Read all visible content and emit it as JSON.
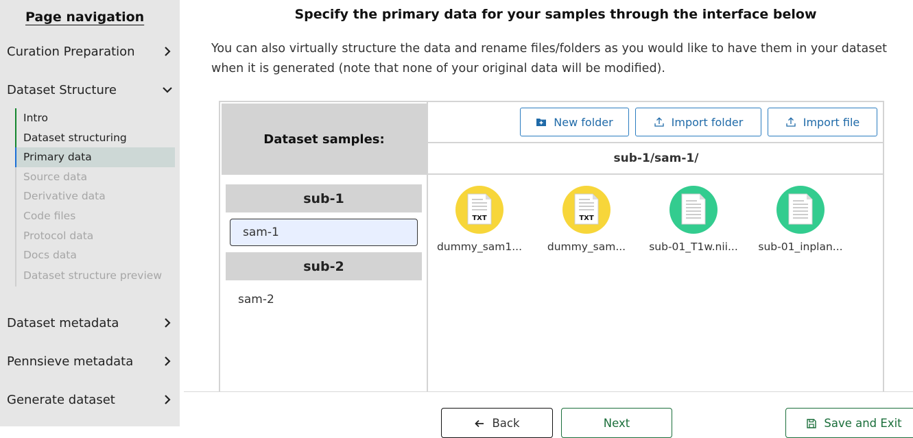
{
  "sidebar": {
    "title": "Page navigation",
    "sections": [
      {
        "label": "Curation Preparation",
        "icon": "chevron-right-icon"
      },
      {
        "label": "Dataset Structure",
        "icon": "chevron-down-icon"
      },
      {
        "label": "Dataset metadata",
        "icon": "chevron-right-icon"
      },
      {
        "label": "Pennsieve metadata",
        "icon": "chevron-right-icon"
      },
      {
        "label": "Generate dataset",
        "icon": "chevron-right-icon"
      }
    ],
    "subitems": [
      {
        "label": "Intro",
        "state": "completed"
      },
      {
        "label": "Dataset structuring",
        "state": "completed"
      },
      {
        "label": "Primary data",
        "state": "active"
      },
      {
        "label": "Source data",
        "state": "pending"
      },
      {
        "label": "Derivative data",
        "state": "pending"
      },
      {
        "label": "Code files",
        "state": "pending"
      },
      {
        "label": "Protocol data",
        "state": "pending"
      },
      {
        "label": "Docs data",
        "state": "pending"
      },
      {
        "label": "Dataset structure preview",
        "state": "pending"
      }
    ]
  },
  "main": {
    "title": "Specify the primary data for your samples through the interface below",
    "description": "You can also virtually structure the data and rename files/folders as you would like to have them in your dataset when it is generated (note that none of your original data will be modified)."
  },
  "panel": {
    "samples_header": "Dataset samples:",
    "toolbar": {
      "new_folder": "New folder",
      "import_folder": "Import folder",
      "import_file": "Import file"
    },
    "current_path": "sub-1/sam-1/",
    "subjects": [
      {
        "name": "sub-1",
        "samples": [
          "sam-1"
        ]
      },
      {
        "name": "sub-2",
        "samples": [
          "sam-2"
        ]
      }
    ],
    "selected_sample": "sam-1",
    "files": [
      {
        "name": "dummy_sam1...",
        "type": "TXT",
        "icon_color": "#f7d63a"
      },
      {
        "name": "dummy_sam...",
        "type": "TXT",
        "icon_color": "#f7d63a"
      },
      {
        "name": "sub-01_T1w.nii...",
        "type": "",
        "icon_color": "#33cc8f"
      },
      {
        "name": "sub-01_inplan...",
        "type": "",
        "icon_color": "#33cc8f"
      }
    ]
  },
  "footer": {
    "back": "Back",
    "next": "Next",
    "save_exit": "Save and Exit"
  },
  "colors": {
    "accent_blue": "#1f6aa8",
    "complete_green": "#13862d",
    "active_blue": "#1b6fd6",
    "txt_icon": "#f7d63a",
    "generic_file_icon": "#33cc8f"
  }
}
